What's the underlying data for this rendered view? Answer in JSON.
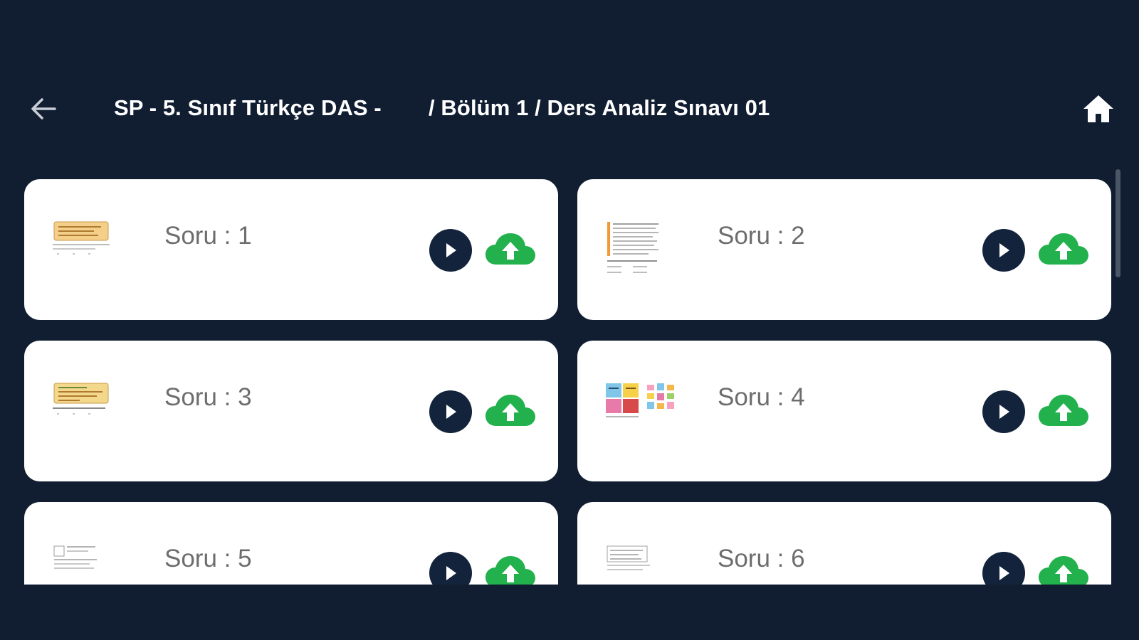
{
  "toolbar": {
    "title_part1": "SP - 5. Sınıf Türkçe DAS -",
    "title_part2": "/ Bölüm 1 / Ders Analiz Sınavı 01",
    "back_icon": "arrow-left-icon",
    "home_icon": "home-icon"
  },
  "colors": {
    "background": "#111e32",
    "card": "#ffffff",
    "label": "#6d6d6d",
    "play_button": "#13233b",
    "upload_icon": "#22b14c"
  },
  "questions": [
    {
      "label": "Soru : 1",
      "thumbnail": "yellow-note-thumbnail"
    },
    {
      "label": "Soru : 2",
      "thumbnail": "text-page-thumbnail"
    },
    {
      "label": "Soru : 3",
      "thumbnail": "yellow-note-thumbnail"
    },
    {
      "label": "Soru : 4",
      "thumbnail": "colorful-grid-thumbnail"
    },
    {
      "label": "Soru : 5",
      "thumbnail": "sketch-thumbnail"
    },
    {
      "label": "Soru : 6",
      "thumbnail": "table-thumbnail"
    }
  ]
}
